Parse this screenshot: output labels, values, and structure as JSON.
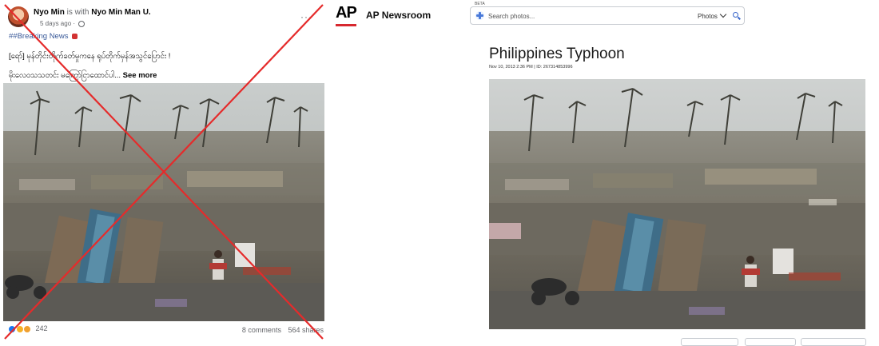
{
  "facebook_post": {
    "author": "Nyo Min",
    "with_text": "is with",
    "tagged": "Nyo Min Man U.",
    "time": "5 days ago",
    "more_menu": "···",
    "hashtag_line": "##Breaking News",
    "headline": "[ရော်] မုန်တိုင်းတိုက်ခတ်မှုကနေ ရုပ်တိုက်မှန်အသွင်ပြောင်း !",
    "body_preview": "မိုးလေဝသသတင်း မကြော်ငြာထောင်ပါ...",
    "see_more": "See more",
    "reaction_count": "242",
    "comments": "8 comments",
    "shares": "564 shares",
    "reaction_colors": [
      "#1877f2",
      "#f7b125",
      "#f0a030"
    ]
  },
  "ap": {
    "logo": "AP",
    "brand": "AP Newsroom",
    "search": {
      "beta_label": "BETA",
      "placeholder": "Search photos...",
      "scope": "Photos"
    },
    "title": "Philippines Typhoon",
    "date": "Nov 10, 2013 2:36 PM",
    "id_label": "ID: 267314853996",
    "accent_color": "#d7282f"
  }
}
